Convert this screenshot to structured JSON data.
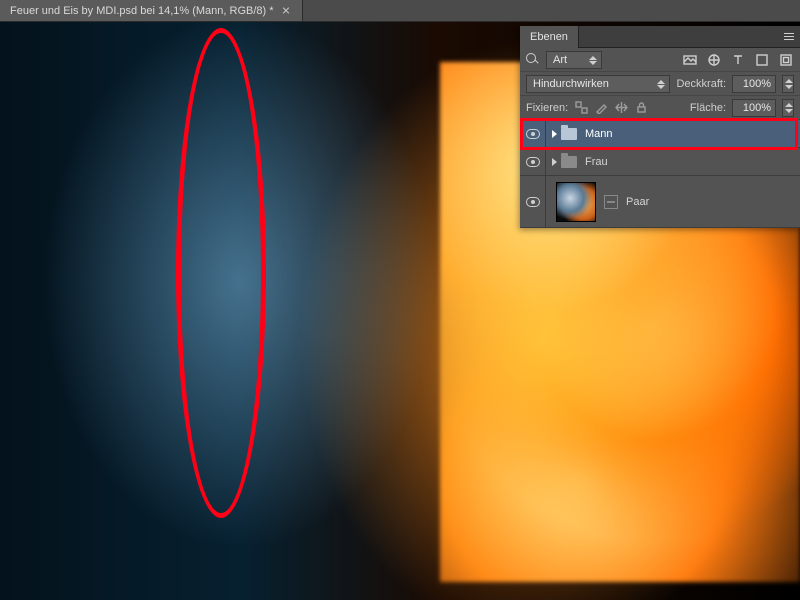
{
  "document": {
    "tab_title": "Feuer und Eis by MDI.psd bei 14,1% (Mann, RGB/8) *"
  },
  "panel": {
    "title": "Ebenen",
    "filter_kind_label": "Art",
    "blend_mode": "Hindurchwirken",
    "opacity_label": "Deckkraft:",
    "opacity_value": "100%",
    "lock_label": "Fixieren:",
    "fill_label": "Fläche:",
    "fill_value": "100%"
  },
  "layers": [
    {
      "name": "Mann",
      "type": "group",
      "selected": true,
      "visible": true
    },
    {
      "name": "Frau",
      "type": "group",
      "selected": false,
      "visible": true
    },
    {
      "name": "Paar",
      "type": "layer",
      "selected": false,
      "visible": true
    }
  ],
  "annotations": {
    "ellipse_region": "transition seam between ice-man and fire-woman",
    "rect_region": "layer row: Mann"
  }
}
